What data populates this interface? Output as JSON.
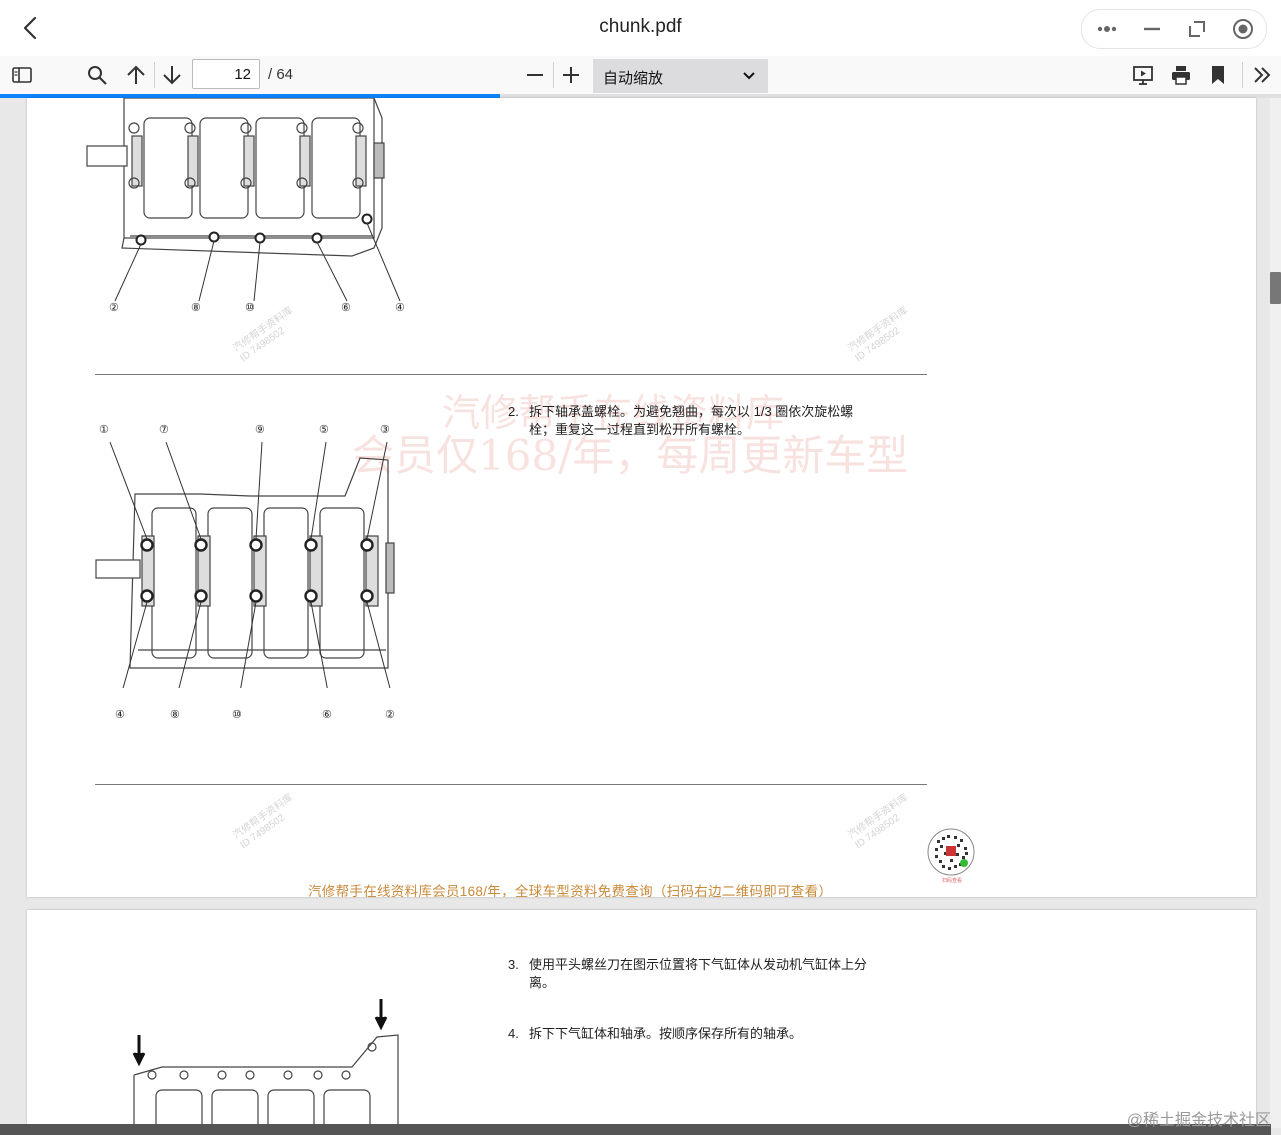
{
  "window": {
    "title": "chunk.pdf"
  },
  "toolbar": {
    "page_current": "12",
    "page_total": "/ 64",
    "zoom_value": "自动缩放",
    "progress_fraction": 0.39
  },
  "page1": {
    "figure1_labels": [
      "②",
      "⑧",
      "⑩",
      "⑥",
      "④"
    ],
    "step2": {
      "num": "2.",
      "line1": "拆下轴承盖螺栓。为避免翘曲，每次以 1/3 圈依次旋松螺",
      "line2": "栓；重复这一过程直到松开所有螺栓。"
    },
    "figure2_top_labels": [
      "①",
      "⑦",
      "⑨",
      "⑤",
      "③"
    ],
    "figure2_bottom_labels": [
      "④",
      "⑧",
      "⑩",
      "⑥",
      "②"
    ],
    "watermark_line1": "汽修帮手在线资料库",
    "watermark_line2": "会员仅168/年，每周更新车型",
    "footer": "汽修帮手在线资料库会员168/年，全球车型资料免费查询（扫码右边二维码即可查看）"
  },
  "page2": {
    "step3": {
      "num": "3.",
      "line1": "使用平头螺丝刀在图示位置将下气缸体从发动机气缸体上分",
      "line2": "离。"
    },
    "step4": {
      "num": "4.",
      "line1": "拆下下气缸体和轴承。按顺序保存所有的轴承。"
    }
  },
  "site_watermark": "@稀土掘金技术社区",
  "colors": {
    "accent": "#0a84ff",
    "footer_text": "#c98a3a",
    "watermark": "#e6968c"
  },
  "icons": [
    "back-arrow-icon",
    "more-icon",
    "minimize-icon",
    "restore-icon",
    "record-icon",
    "sidebar-toggle-icon",
    "search-icon",
    "arrow-up-icon",
    "arrow-down-icon",
    "zoom-out-icon",
    "zoom-in-icon",
    "chevron-down-icon",
    "presentation-icon",
    "print-icon",
    "bookmark-icon",
    "double-chevron-right-icon"
  ]
}
